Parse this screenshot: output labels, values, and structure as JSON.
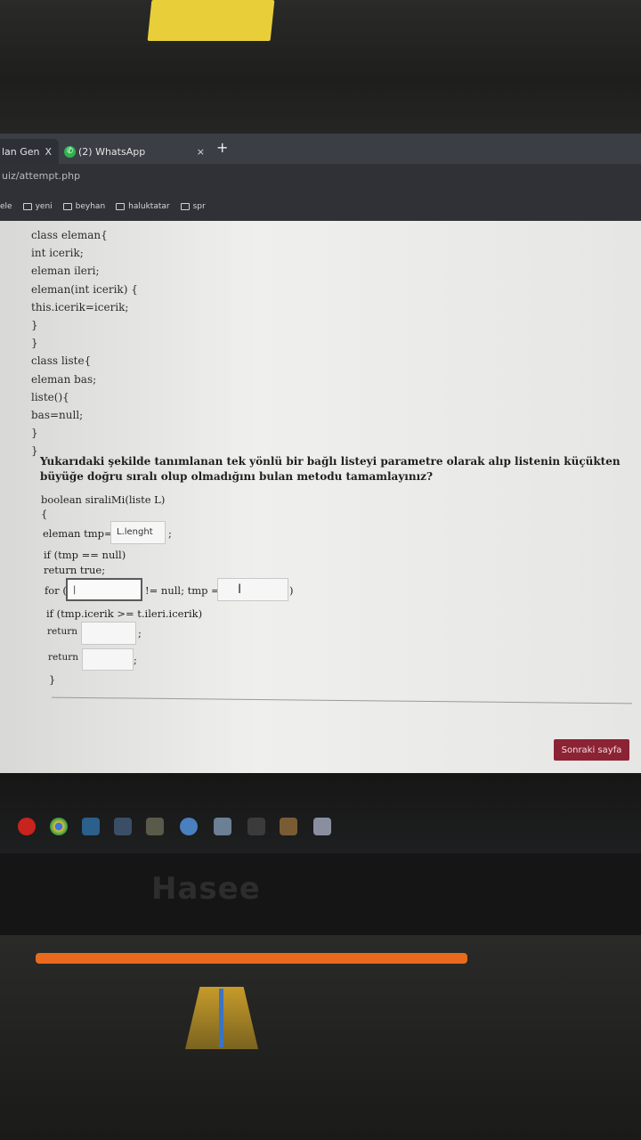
{
  "browser": {
    "tabs": [
      {
        "label": "lan Gen",
        "close": "X"
      },
      {
        "label": "(2) WhatsApp",
        "badge": "✆",
        "close": "×"
      }
    ],
    "new_tab": "+",
    "url": "uiz/attempt.php",
    "bookmarks": [
      "ele",
      "yeni",
      "beyhan",
      "haluktatar",
      "spr"
    ]
  },
  "code_lines": [
    "class eleman{",
    "int icerik;",
    "eleman ileri;",
    "eleman(int icerik) {",
    "this.icerik=icerik;",
    "}",
    "}",
    "class liste{",
    "eleman bas;",
    "liste(){",
    "bas=null;",
    "}",
    "}"
  ],
  "question_text": "Yukarıdaki şekilde tanımlanan tek yönlü bir bağlı listeyi parametre olarak alıp listenin küçükten büyüğe doğru sıralı olup olmadığını bulan metodu tamamlayınız?",
  "method": {
    "signature": "boolean siraliMi(liste L)",
    "open_brace": "{",
    "line_tmp_prefix": "eleman tmp=",
    "blank1_value": "L.lenght",
    "line_tmp_suffix": ";",
    "line_if": "if (tmp == null)",
    "line_return_true": "return true;",
    "for_prefix": "for (",
    "for_mid": "!= null; tmp =",
    "for_suffix": ")",
    "blank2_value": "|",
    "blank3_value": "I",
    "line_if2": "if (tmp.icerik >= t.ileri.icerik)",
    "return_label": "return",
    "semicolon": ";",
    "close_brace": "}"
  },
  "next_button_label": "Sonraki sayfa",
  "brand": "Hasee"
}
